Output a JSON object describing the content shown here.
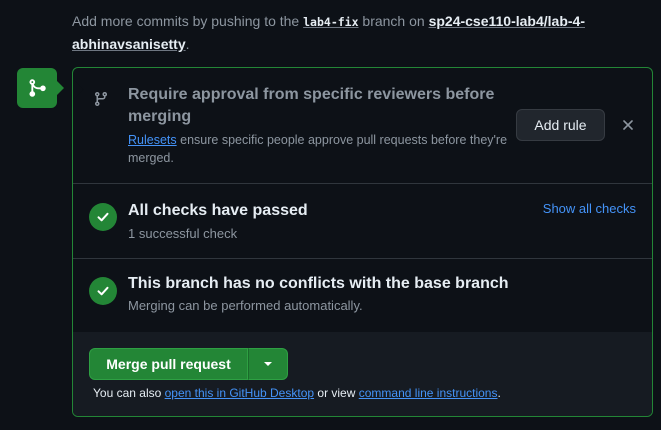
{
  "push_note": {
    "prefix": "Add more commits by pushing to the",
    "branch": "lab4-fix",
    "middle": "branch on",
    "repo": "sp24-cse110-lab4/lab-4-abhinavsanisetty",
    "suffix": "."
  },
  "ruleset": {
    "title": "Require approval from specific reviewers before merging",
    "link": "Rulesets",
    "desc": "ensure specific people approve pull requests before they're merged.",
    "add_rule_label": "Add rule",
    "close_glyph": "×"
  },
  "checks": {
    "title": "All checks have passed",
    "subtitle": "1 successful check",
    "show_all_label": "Show all checks"
  },
  "conflicts": {
    "title": "This branch has no conflicts with the base branch",
    "subtitle": "Merging can be performed automatically."
  },
  "merge": {
    "button_label": "Merge pull request",
    "help_prefix": "You can also",
    "desktop_link": "open this in GitHub Desktop",
    "help_middle": "or view",
    "cli_link": "command line instructions",
    "help_suffix": "."
  },
  "colors": {
    "accent_green": "#238636",
    "link_blue": "#4493f8",
    "background": "#0d1117"
  },
  "icons": {
    "badge": "git-merge-icon",
    "ruleset": "git-branch-icon",
    "check": "check-icon",
    "close": "close-icon",
    "caret": "triangle-down-icon"
  }
}
